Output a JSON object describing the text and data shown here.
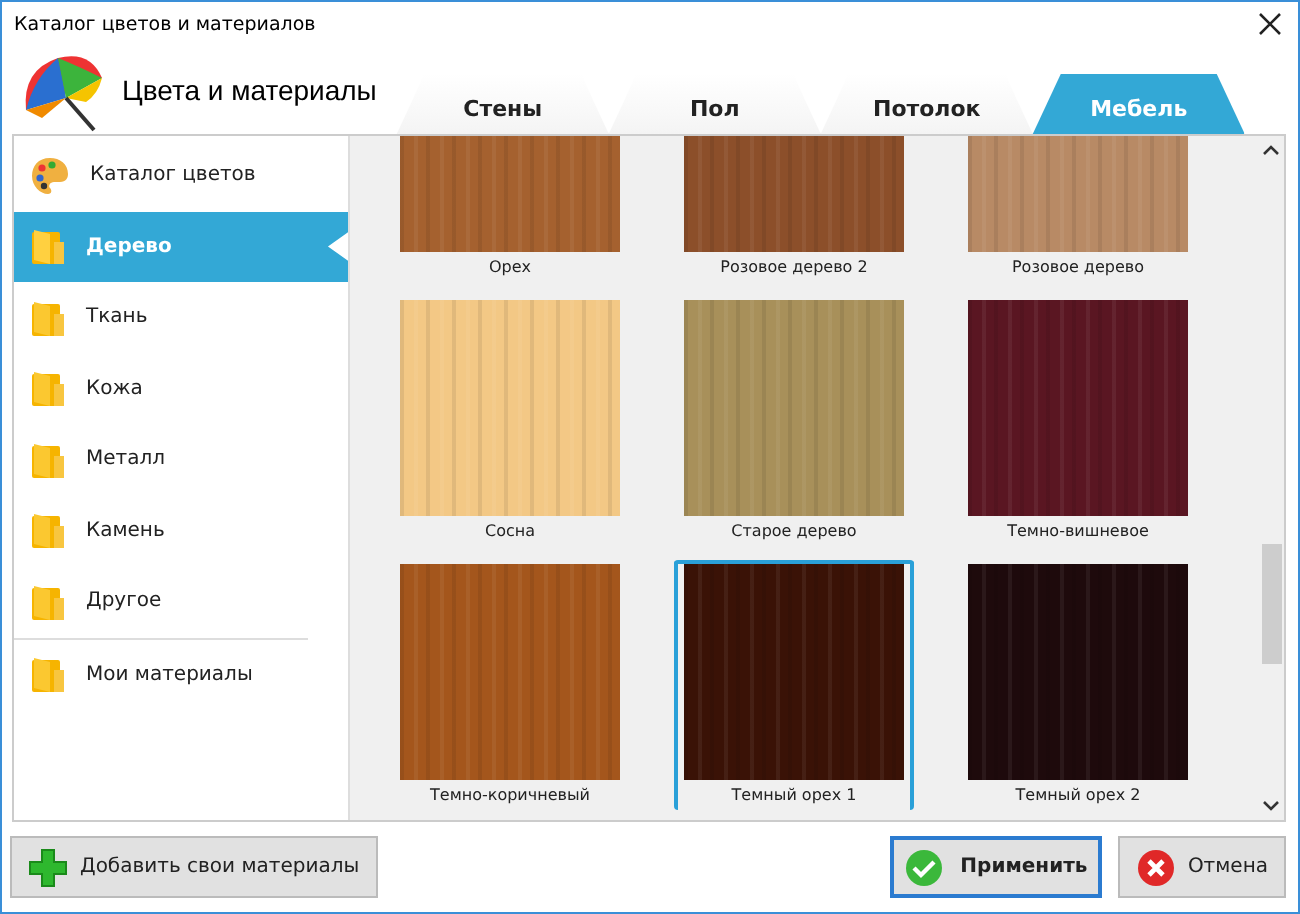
{
  "window": {
    "title": "Каталог цветов и материалов"
  },
  "header": {
    "title": "Цвета и материалы"
  },
  "tabs": [
    {
      "label": "Стены",
      "selected": false
    },
    {
      "label": "Пол",
      "selected": false
    },
    {
      "label": "Потолок",
      "selected": false
    },
    {
      "label": "Мебель",
      "selected": true
    }
  ],
  "sidebar": {
    "items": [
      {
        "label": "Каталог цветов",
        "kind": "palette",
        "selected": false
      },
      {
        "label": "Дерево",
        "kind": "folder",
        "selected": true
      },
      {
        "label": "Ткань",
        "kind": "folder",
        "selected": false
      },
      {
        "label": "Кожа",
        "kind": "folder",
        "selected": false
      },
      {
        "label": "Металл",
        "kind": "folder",
        "selected": false
      },
      {
        "label": "Камень",
        "kind": "folder",
        "selected": false
      },
      {
        "label": "Другое",
        "kind": "folder",
        "selected": false
      }
    ],
    "user_items": [
      {
        "label": "Мои материалы",
        "kind": "folder",
        "selected": false
      }
    ]
  },
  "materials": [
    {
      "label": "Орех",
      "color": "#a5612f",
      "selected": false
    },
    {
      "label": "Розовое дерево 2",
      "color": "#8c4f2a",
      "selected": false
    },
    {
      "label": "Розовое дерево",
      "color": "#b88a65",
      "selected": false
    },
    {
      "label": "Сосна",
      "color": "#f3c885",
      "selected": false
    },
    {
      "label": "Старое дерево",
      "color": "#a8905a",
      "selected": false
    },
    {
      "label": "Темно-вишневое",
      "color": "#5a1622",
      "selected": false
    },
    {
      "label": "Темно-коричневый",
      "color": "#a4561c",
      "selected": false
    },
    {
      "label": "Темный орех 1",
      "color": "#3a1206",
      "selected": true
    },
    {
      "label": "Темный орех 2",
      "color": "#1e0a0c",
      "selected": false
    }
  ],
  "buttons": {
    "add": "Добавить свои материалы",
    "apply": "Применить",
    "cancel": "Отмена"
  }
}
